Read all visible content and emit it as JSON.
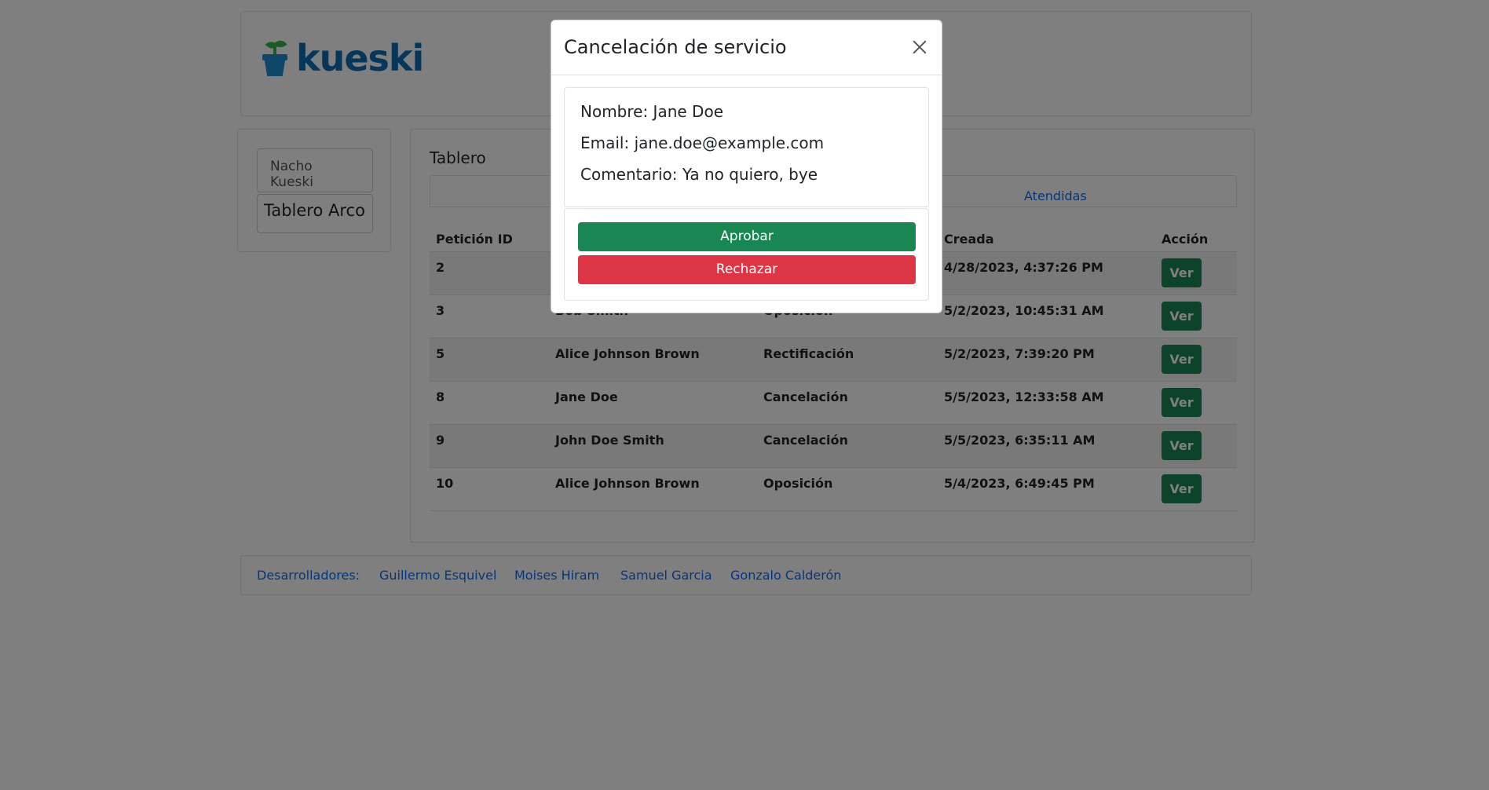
{
  "header": {
    "logo_text": "kueski"
  },
  "sidebar": {
    "user": "Nacho Kueski",
    "board": "Tablero Arco"
  },
  "main": {
    "title": "Tablero",
    "tabs": {
      "atendidas": "Atendidas"
    },
    "columns": {
      "id": "Petición ID",
      "name": "",
      "type": "",
      "created": "Creada",
      "action": "Acción"
    },
    "rows": [
      {
        "id": "2",
        "name": "",
        "type": "",
        "created": "4/28/2023, 4:37:26 PM",
        "action": "Ver"
      },
      {
        "id": "3",
        "name": "Bob Smith",
        "type": "Oposición",
        "created": "5/2/2023, 10:45:31 AM",
        "action": "Ver"
      },
      {
        "id": "5",
        "name": "Alice Johnson Brown",
        "type": "Rectificación",
        "created": "5/2/2023, 7:39:20 PM",
        "action": "Ver"
      },
      {
        "id": "8",
        "name": "Jane Doe",
        "type": "Cancelación",
        "created": "5/5/2023, 12:33:58 AM",
        "action": "Ver"
      },
      {
        "id": "9",
        "name": "John Doe Smith",
        "type": "Cancelación",
        "created": "5/5/2023, 6:35:11 AM",
        "action": "Ver"
      },
      {
        "id": "10",
        "name": "Alice Johnson Brown",
        "type": "Oposición",
        "created": "5/4/2023, 6:49:45 PM",
        "action": "Ver"
      }
    ]
  },
  "footer": {
    "label": "Desarrolladores:",
    "devs": [
      "Guillermo Esquivel",
      "Moises Hiram",
      "Samuel Garcia",
      "Gonzalo Calderón"
    ]
  },
  "modal": {
    "title": "Cancelación de servicio",
    "nombre": "Nombre: Jane Doe",
    "email": "Email: jane.doe@example.com",
    "comentario": "Comentario: Ya no quiero, bye",
    "approve": "Aprobar",
    "reject": "Rechazar"
  },
  "colors": {
    "success": "#198754",
    "danger": "#dc3545",
    "link": "#0d6efd",
    "logo_blue": "#0d6eb5",
    "logo_green": "#3bb54a"
  }
}
